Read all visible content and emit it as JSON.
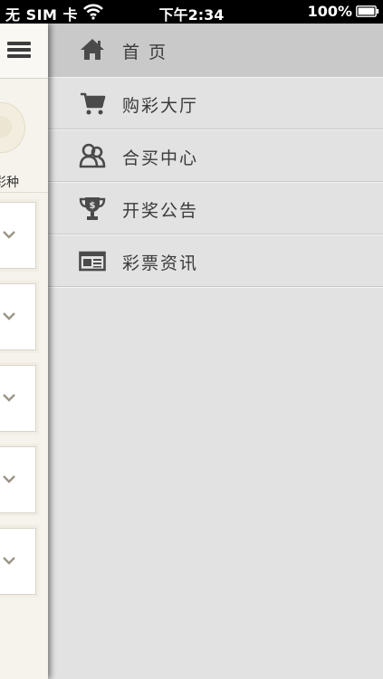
{
  "status_bar": {
    "carrier": "无 SIM 卡",
    "time": "下午2:34",
    "battery": "100%"
  },
  "main_page": {
    "lottery_label": "彩种",
    "cards": [
      {
        "icon": "chevron-down-icon"
      },
      {
        "icon": "chevron-down-icon"
      },
      {
        "icon": "chevron-down-icon"
      },
      {
        "icon": "chevron-down-icon"
      },
      {
        "icon": "chevron-down-icon"
      }
    ]
  },
  "menu": {
    "items": [
      {
        "label": "首 页",
        "icon": "home-icon",
        "active": true
      },
      {
        "label": "购彩大厅",
        "icon": "cart-icon",
        "active": false
      },
      {
        "label": "合买中心",
        "icon": "users-icon",
        "active": false
      },
      {
        "label": "开奖公告",
        "icon": "trophy-icon",
        "active": false
      },
      {
        "label": "彩票资讯",
        "icon": "newspaper-icon",
        "active": false
      }
    ]
  },
  "colors": {
    "drawer_bg": "#e2e2e2",
    "active_bg": "#c9c9c9",
    "main_bg": "#f6f3ec",
    "icon": "#4a4a4a"
  }
}
